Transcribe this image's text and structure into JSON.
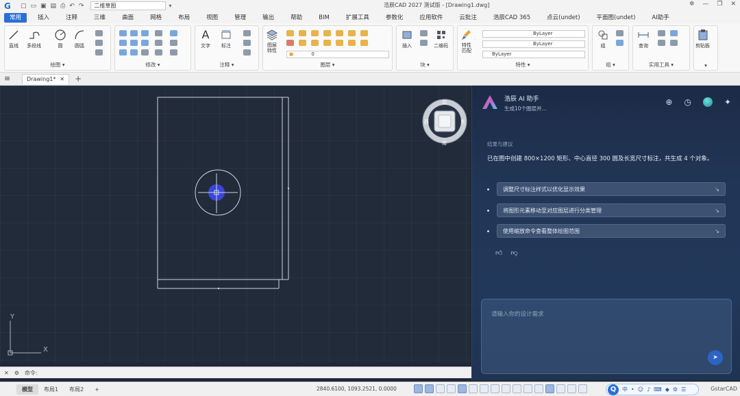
{
  "titlebar": {
    "app_icon": "app-logo-icon",
    "workspace": "二维草图",
    "app_title": "浩辰CAD 2027 测试版 - [Drawing1.dwg]",
    "window_controls": [
      "help-icon",
      "minimize-icon",
      "maximize-icon",
      "close-icon"
    ]
  },
  "tabs": [
    {
      "label": "常用",
      "active": true
    },
    {
      "label": "插入"
    },
    {
      "label": "注释"
    },
    {
      "label": "三维"
    },
    {
      "label": "曲面"
    },
    {
      "label": "网格"
    },
    {
      "label": "布局"
    },
    {
      "label": "视图"
    },
    {
      "label": "管理"
    },
    {
      "label": "输出"
    },
    {
      "label": "帮助"
    },
    {
      "label": "BIM"
    },
    {
      "label": "扩展工具"
    },
    {
      "label": "参数化"
    },
    {
      "label": "应用软件"
    },
    {
      "label": "云批注"
    },
    {
      "label": "浩辰CAD 365"
    },
    {
      "label": "点云(undet)"
    },
    {
      "label": "平面图(undet)"
    },
    {
      "label": "AI助手"
    }
  ],
  "ribbon": {
    "draw": {
      "title": "绘图 ▾",
      "line": "直线",
      "polyline": "多段线",
      "circle": "圆",
      "arc": "圆弧"
    },
    "modify": {
      "title": "修改 ▾"
    },
    "annotation": {
      "title": "注释 ▾",
      "text": "文字",
      "dimension": "标注"
    },
    "layers": {
      "title": "图层 ▾",
      "properties": "图层\n特性",
      "current_layer": "0"
    },
    "block": {
      "title": "块 ▾",
      "insert": "插入",
      "qrcode": "二维码"
    },
    "properties": {
      "title": "特性 ▾",
      "match": "特性\n匹配",
      "color": "ByLayer",
      "linetype": "ByLayer",
      "lineweight": "ByLayer"
    },
    "group": {
      "title": "组 ▾",
      "group": "组"
    },
    "utilities": {
      "title": "实用工具 ▾",
      "measure": "查询"
    },
    "clipboard": {
      "title": "▾",
      "paste": "剪贴板"
    }
  },
  "doc": {
    "tab": "Drawing1*"
  },
  "viewcube": {
    "north": "北",
    "south": "南",
    "west": "西",
    "east": "东"
  },
  "ucs": {
    "x": "X",
    "y": "Y"
  },
  "cmdline": {
    "prompt": "命令:"
  },
  "statusbar": {
    "tabs": [
      "模型",
      "布局1",
      "布局2"
    ],
    "add": "+",
    "coords": "2840.6100, 1093.2521, 0.0000",
    "brand": "GstarCAD"
  },
  "ai": {
    "title": "浩辰 AI 助手",
    "subtitle": "生成10个图层并...",
    "section": "结果与建议",
    "summary": "已在图中创建 800×1200 矩形、中心直径 300 圆及长宽尺寸标注，共生成 4 个对象。",
    "suggestions": [
      "调整尺寸标注样式以优化显示效果",
      "将图形元素移动至对应图层进行分类管理",
      "使用缩放命令查看整体绘图范围"
    ],
    "input_placeholder": "请输入你的设计需求"
  }
}
